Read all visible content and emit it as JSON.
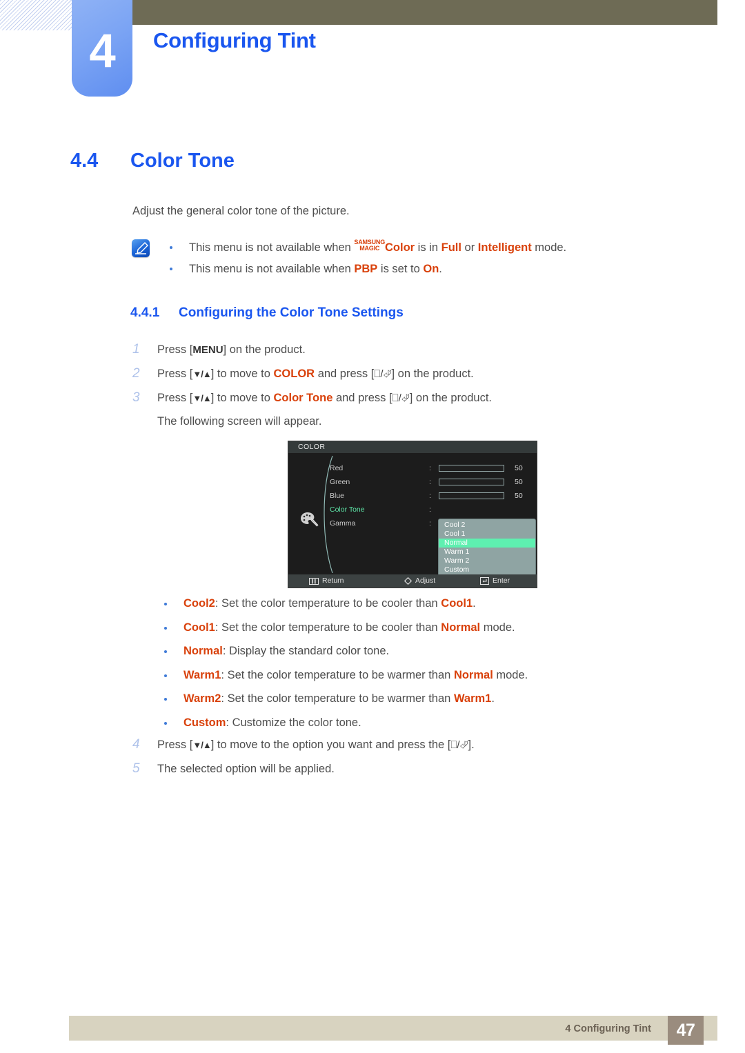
{
  "header": {
    "chapter_number": "4",
    "chapter_title": "Configuring Tint"
  },
  "section": {
    "number": "4.4",
    "title": "Color Tone",
    "intro": "Adjust the general color tone of the picture."
  },
  "notes": {
    "icon": "note-pen-icon",
    "items": [
      {
        "prefix": "This menu is not available when ",
        "magic_top": "SAMSUNG",
        "magic_bottom": "MAGIC",
        "kw1": "Color",
        "mid1": " is in ",
        "kw2": "Full",
        "mid2": " or ",
        "kw3": "Intelligent",
        "suffix": " mode."
      },
      {
        "prefix": "This menu is not available when ",
        "kw1": "PBP",
        "mid1": " is set to ",
        "kw2": "On",
        "suffix": "."
      }
    ]
  },
  "subsection": {
    "number": "4.4.1",
    "title": "Configuring the Color Tone Settings"
  },
  "steps": [
    {
      "n": "1",
      "a": "Press [",
      "key": "MENU",
      "b": "] on the product."
    },
    {
      "n": "2",
      "a": "Press [",
      "arrows": "▼/▲",
      "b": "] to move to ",
      "kw": "COLOR",
      "c": " and press [",
      "d": "] on the product."
    },
    {
      "n": "3",
      "a": "Press [",
      "arrows": "▼/▲",
      "b": "] to move to ",
      "kw": "Color Tone",
      "c": " and press [",
      "d": "] on the product."
    }
  ],
  "step3_followup": "The following screen will appear.",
  "steps_tail": [
    {
      "n": "4",
      "a": "Press [",
      "arrows": "▼/▲",
      "b": "] to move to the option you want and press the [",
      "d": "]."
    },
    {
      "n": "5",
      "a": "The selected option will be applied."
    }
  ],
  "osd": {
    "title": "COLOR",
    "palette_icon": "palette-icon",
    "rows": [
      {
        "label": "Red",
        "colon": ":",
        "value": "50",
        "fill_pct": 50,
        "selected": false
      },
      {
        "label": "Green",
        "colon": ":",
        "value": "50",
        "fill_pct": 50,
        "selected": false
      },
      {
        "label": "Blue",
        "colon": ":",
        "value": "50",
        "fill_pct": 50,
        "selected": false
      },
      {
        "label": "Color Tone",
        "colon": ":",
        "value": "",
        "fill_pct": 0,
        "selected": true
      },
      {
        "label": "Gamma",
        "colon": ":",
        "value": "",
        "fill_pct": 0,
        "selected": false
      }
    ],
    "dropdown": {
      "items": [
        "Cool 2",
        "Cool 1",
        "Normal",
        "Warm 1",
        "Warm 2",
        "Custom"
      ],
      "highlighted": "Normal",
      "highlight_color": "#5ef0b0",
      "background_color": "#8fa4a3"
    },
    "footer": {
      "return_label": "Return",
      "return_icon": "menu-bars-icon",
      "adjust_label": "Adjust",
      "adjust_icon": "diamond-icon",
      "enter_label": "Enter",
      "enter_icon": "enter-key-icon"
    }
  },
  "options": [
    {
      "name": "Cool2",
      "sep": ": ",
      "a": "Set the color temperature to be cooler than ",
      "kw": "Cool1",
      "b": "."
    },
    {
      "name": "Cool1",
      "sep": ": ",
      "a": "Set the color temperature to be cooler than ",
      "kw": "Normal",
      "b": " mode."
    },
    {
      "name": "Normal",
      "sep": ": ",
      "a": "Display the standard color tone.",
      "kw": "",
      "b": ""
    },
    {
      "name": "Warm1",
      "sep": ": ",
      "a": "Set the color temperature to be warmer than ",
      "kw": "Normal",
      "b": " mode."
    },
    {
      "name": "Warm2",
      "sep": ": ",
      "a": "Set the color temperature to be warmer than ",
      "kw": "Warm1",
      "b": "."
    },
    {
      "name": "Custom",
      "sep": ": ",
      "a": "Customize the color tone.",
      "kw": "",
      "b": ""
    }
  ],
  "footer": {
    "chapter_ref": "4 Configuring Tint",
    "page_number": "47"
  },
  "colors": {
    "heading_blue": "#1a56ef",
    "keyword_orange": "#d9410b",
    "header_olive": "#6e6b55",
    "tab_blue": "#7ba4f4",
    "footer_beige": "#d8d3c0",
    "page_box_brown": "#9a8c7e",
    "osd_highlight": "#5ef0b0"
  }
}
